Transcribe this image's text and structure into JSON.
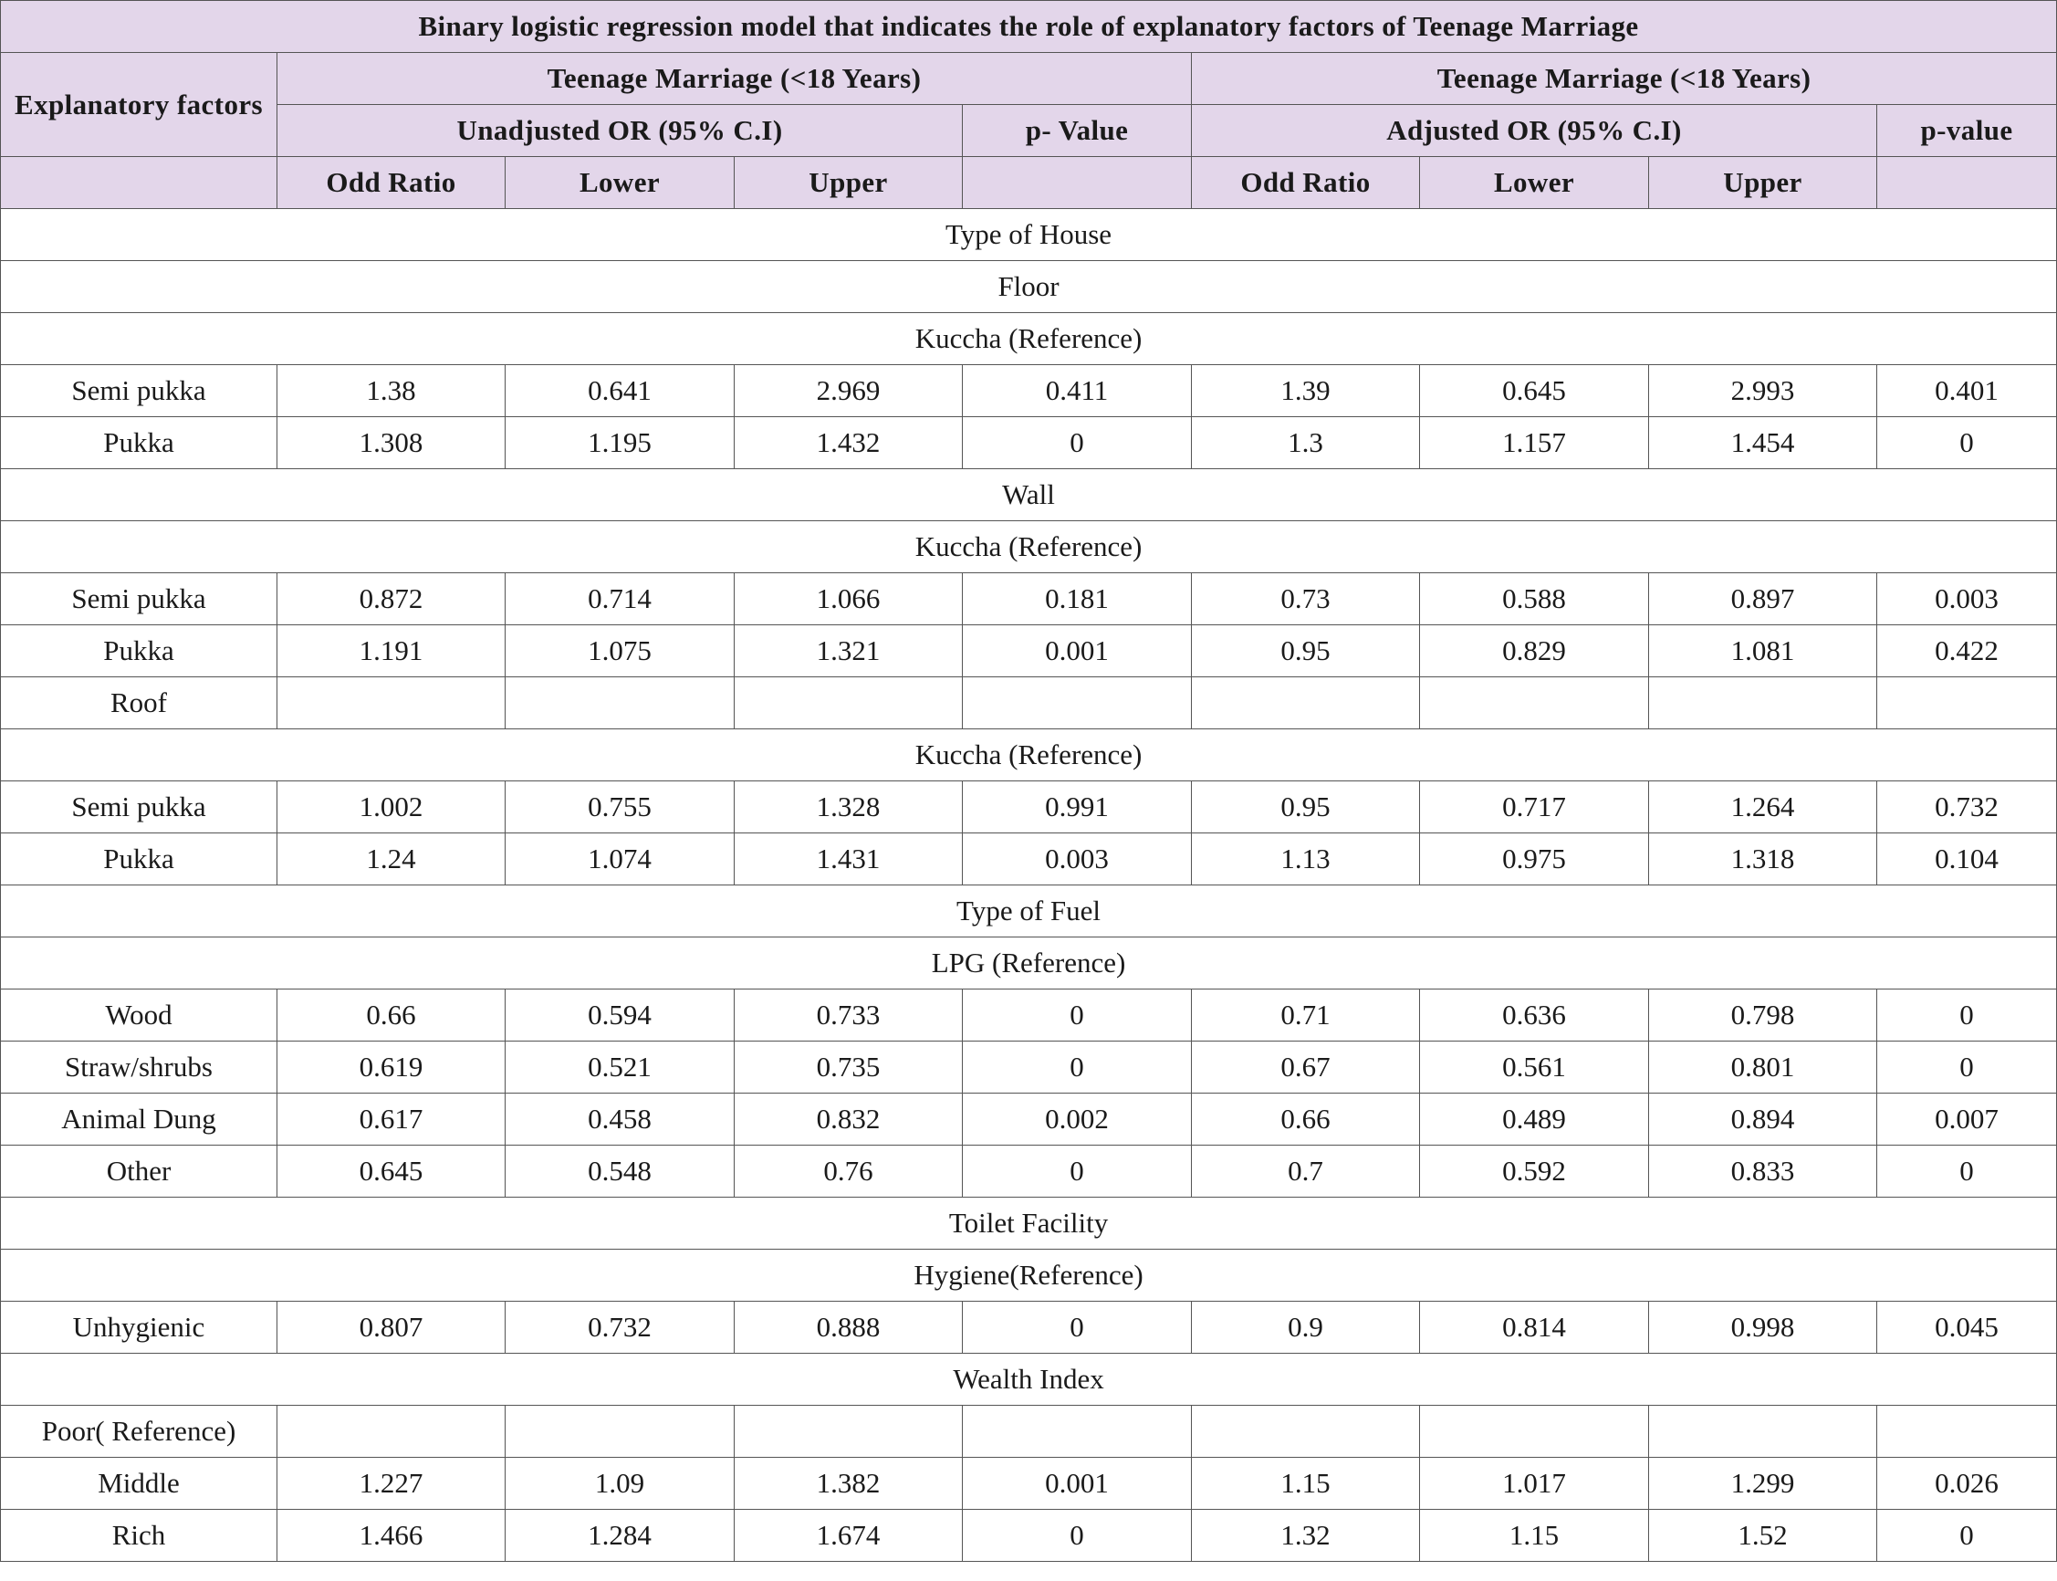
{
  "title": "Binary logistic regression model that indicates the role of explanatory factors of Teenage Marriage",
  "header": {
    "explanatory": "Explanatory factors",
    "group_left": "Teenage Marriage (<18 Years)",
    "group_right": "Teenage Marriage (<18 Years)",
    "unadjusted": "Unadjusted OR (95% C.I)",
    "p_left": "p- Value",
    "adjusted": "Adjusted OR (95% C.I)",
    "p_right": "p-value",
    "cols": [
      "Odd Ratio",
      "Lower",
      "Upper",
      "",
      "Odd Ratio",
      "Lower",
      "Upper",
      ""
    ]
  },
  "rows": [
    {
      "type": "section",
      "label": "Type of House"
    },
    {
      "type": "section",
      "label": "Floor"
    },
    {
      "type": "section",
      "label": "Kuccha (Reference)"
    },
    {
      "type": "data",
      "label": "Semi pukka",
      "values": [
        "1.38",
        "0.641",
        "2.969",
        "0.411",
        "1.39",
        "0.645",
        "2.993",
        "0.401"
      ]
    },
    {
      "type": "data",
      "label": "Pukka",
      "values": [
        "1.308",
        "1.195",
        "1.432",
        "0",
        "1.3",
        "1.157",
        "1.454",
        "0"
      ]
    },
    {
      "type": "section",
      "label": "Wall"
    },
    {
      "type": "section",
      "label": "Kuccha (Reference)"
    },
    {
      "type": "data",
      "label": "Semi pukka",
      "values": [
        "0.872",
        "0.714",
        "1.066",
        "0.181",
        "0.73",
        "0.588",
        "0.897",
        "0.003"
      ]
    },
    {
      "type": "data",
      "label": "Pukka",
      "values": [
        "1.191",
        "1.075",
        "1.321",
        "0.001",
        "0.95",
        "0.829",
        "1.081",
        "0.422"
      ]
    },
    {
      "type": "data",
      "label": "Roof",
      "values": [
        "",
        "",
        "",
        "",
        "",
        "",
        "",
        ""
      ]
    },
    {
      "type": "section",
      "label": "Kuccha (Reference)"
    },
    {
      "type": "data",
      "label": "Semi pukka",
      "values": [
        "1.002",
        "0.755",
        "1.328",
        "0.991",
        "0.95",
        "0.717",
        "1.264",
        "0.732"
      ]
    },
    {
      "type": "data",
      "label": "Pukka",
      "values": [
        "1.24",
        "1.074",
        "1.431",
        "0.003",
        "1.13",
        "0.975",
        "1.318",
        "0.104"
      ]
    },
    {
      "type": "section",
      "label": "Type of Fuel"
    },
    {
      "type": "section",
      "label": "LPG (Reference)"
    },
    {
      "type": "data",
      "label": "Wood",
      "values": [
        "0.66",
        "0.594",
        "0.733",
        "0",
        "0.71",
        "0.636",
        "0.798",
        "0"
      ]
    },
    {
      "type": "data",
      "label": "Straw/shrubs",
      "values": [
        "0.619",
        "0.521",
        "0.735",
        "0",
        "0.67",
        "0.561",
        "0.801",
        "0"
      ]
    },
    {
      "type": "data",
      "label": "Animal Dung",
      "values": [
        "0.617",
        "0.458",
        "0.832",
        "0.002",
        "0.66",
        "0.489",
        "0.894",
        "0.007"
      ]
    },
    {
      "type": "data",
      "label": "Other",
      "values": [
        "0.645",
        "0.548",
        "0.76",
        "0",
        "0.7",
        "0.592",
        "0.833",
        "0"
      ]
    },
    {
      "type": "section",
      "label": "Toilet Facility"
    },
    {
      "type": "section",
      "label": "Hygiene(Reference)"
    },
    {
      "type": "data",
      "label": "Unhygienic",
      "values": [
        "0.807",
        "0.732",
        "0.888",
        "0",
        "0.9",
        "0.814",
        "0.998",
        "0.045"
      ]
    },
    {
      "type": "section",
      "label": "Wealth Index"
    },
    {
      "type": "data",
      "label": "Poor( Reference)",
      "values": [
        "",
        "",
        "",
        "",
        "",
        "",
        "",
        ""
      ]
    },
    {
      "type": "data",
      "label": "Middle",
      "values": [
        "1.227",
        "1.09",
        "1.382",
        "0.001",
        "1.15",
        "1.017",
        "1.299",
        "0.026"
      ]
    },
    {
      "type": "data",
      "label": "Rich",
      "values": [
        "1.466",
        "1.284",
        "1.674",
        "0",
        "1.32",
        "1.15",
        "1.52",
        "0"
      ]
    }
  ]
}
